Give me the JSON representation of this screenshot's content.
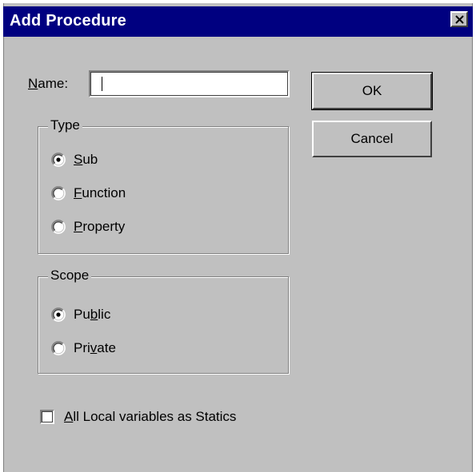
{
  "title": "Add Procedure",
  "name_field": {
    "label_prefix": "",
    "label_accel": "N",
    "label_rest": "ame:",
    "value": ""
  },
  "buttons": {
    "ok": "OK",
    "cancel": "Cancel"
  },
  "type_group": {
    "title": "Type",
    "options": [
      {
        "accel": "S",
        "rest": "ub",
        "pre": "",
        "selected": true
      },
      {
        "accel": "F",
        "rest": "unction",
        "pre": "",
        "selected": false
      },
      {
        "accel": "P",
        "rest": "roperty",
        "pre": "",
        "selected": false
      }
    ]
  },
  "scope_group": {
    "title": "Scope",
    "options": [
      {
        "pre": "Pu",
        "accel": "b",
        "rest": "lic",
        "selected": true
      },
      {
        "pre": "Pri",
        "accel": "v",
        "rest": "ate",
        "selected": false
      }
    ]
  },
  "statics_checkbox": {
    "accel": "A",
    "rest": "ll Local variables as Statics",
    "checked": false
  },
  "colors": {
    "titlebar": "#000080",
    "face": "#c0c0c0"
  }
}
